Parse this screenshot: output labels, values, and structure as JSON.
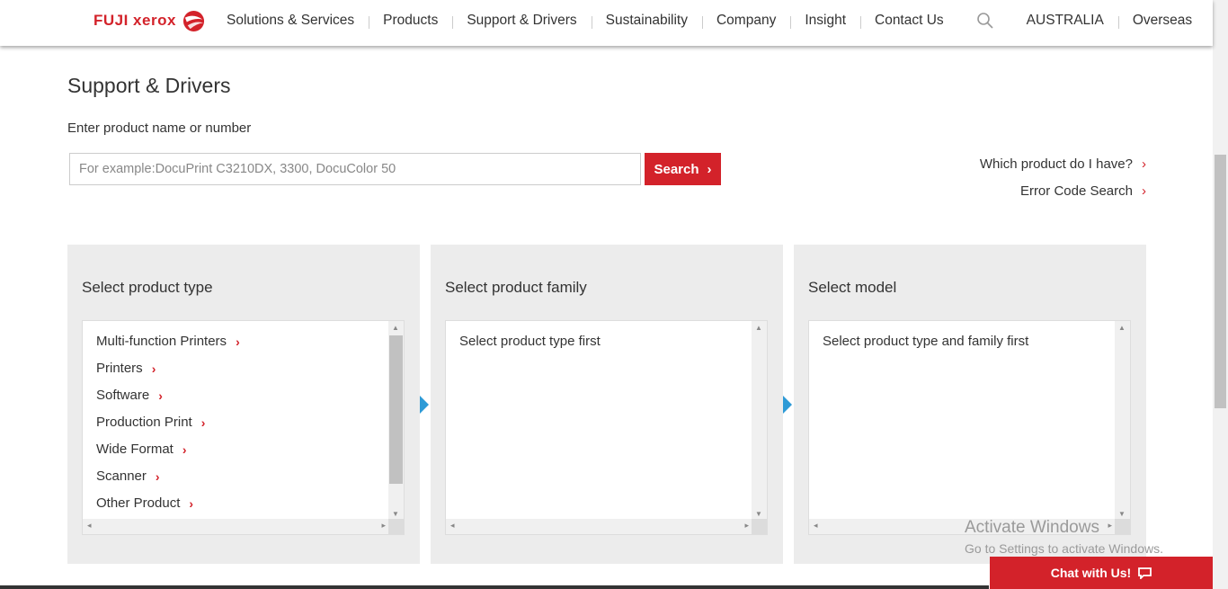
{
  "header": {
    "logo_text": "FUJI xerox",
    "nav": [
      "Solutions & Services",
      "Products",
      "Support & Drivers",
      "Sustainability",
      "Company",
      "Insight",
      "Contact Us"
    ],
    "region": "AUSTRALIA",
    "overseas": "Overseas"
  },
  "main": {
    "title": "Support & Drivers",
    "search_label": "Enter product name or number",
    "search_placeholder": "For example:DocuPrint C3210DX, 3300, DocuColor 50",
    "search_button": "Search",
    "links": {
      "which_product": "Which product do I have?",
      "error_code": "Error Code Search"
    }
  },
  "panels": {
    "type": {
      "title": "Select product type",
      "items": [
        "Multi-function Printers",
        "Printers",
        "Software",
        "Production Print",
        "Wide Format",
        "Scanner",
        "Other Product"
      ]
    },
    "family": {
      "title": "Select product family",
      "placeholder": "Select product type first"
    },
    "model": {
      "title": "Select model",
      "placeholder": "Select product type and family first"
    }
  },
  "watermark": {
    "title": "Activate Windows",
    "subtitle": "Go to Settings to activate Windows."
  },
  "chat": {
    "label": "Chat with Us!"
  },
  "colors": {
    "brand_red": "#d3222a",
    "arrow_blue": "#2d9ad6",
    "panel_bg": "#ececec"
  }
}
